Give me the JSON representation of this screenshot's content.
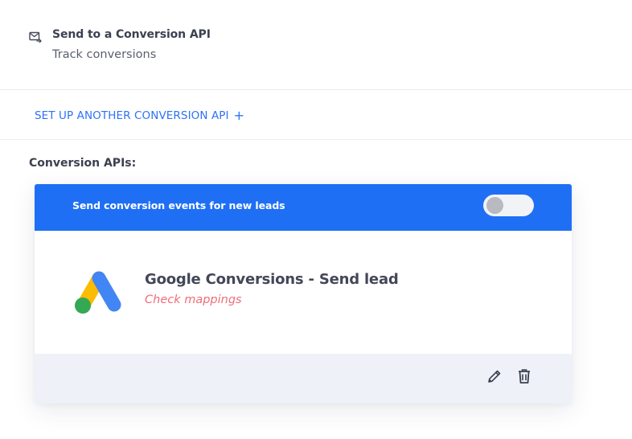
{
  "header": {
    "icon": "mail-send-icon",
    "title": "Send to a Conversion API",
    "subtitle": "Track conversions"
  },
  "setup": {
    "label": "SET UP ANOTHER CONVERSION API",
    "plus": "+"
  },
  "section": {
    "label": "Conversion APIs:"
  },
  "card": {
    "header_text": "Send conversion events for new leads",
    "toggle_on": false,
    "integration": {
      "logo": "google-ads-logo",
      "title": "Google Conversions - Send lead",
      "status": "Check mappings"
    },
    "actions": {
      "edit_icon": "pencil-icon",
      "delete_icon": "trash-icon"
    }
  },
  "colors": {
    "accent": "#1f6ff5",
    "link": "#2e72f5",
    "warning_text": "#ef6d78",
    "footer_bg": "#eef1f8"
  }
}
